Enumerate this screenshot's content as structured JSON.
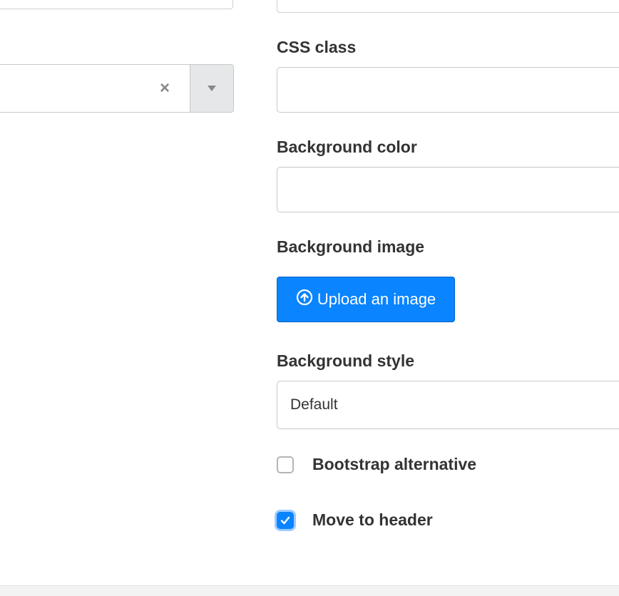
{
  "fields": {
    "css_class": {
      "label": "CSS class",
      "value": ""
    },
    "background_color": {
      "label": "Background color",
      "value": ""
    },
    "background_image": {
      "label": "Background image",
      "button_label": "Upload an image",
      "icon": "upload-circle-icon"
    },
    "background_style": {
      "label": "Background style",
      "selected": "Default"
    }
  },
  "left_select": {
    "clear_glyph": "×",
    "icon": "chevron-down-icon"
  },
  "checkboxes": {
    "bootstrap_alternative": {
      "label": "Bootstrap alternative",
      "checked": false
    },
    "move_to_header": {
      "label": "Move to header",
      "checked": true
    }
  },
  "colors": {
    "primary": "#0a84ff",
    "text": "#333333",
    "border": "#c7c7c7"
  }
}
